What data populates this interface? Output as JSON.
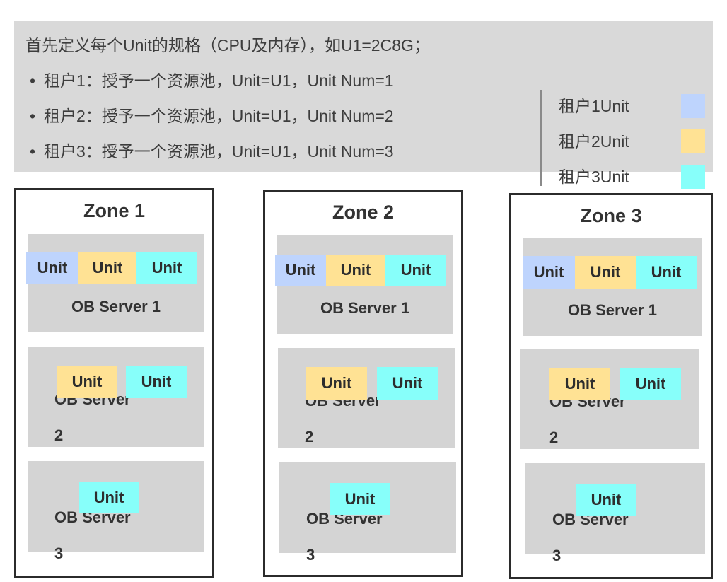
{
  "header": {
    "intro": "首先定义每个Unit的规格（CPU及内存），如U1=2C8G；",
    "bullet_glyph": "•",
    "bullets": [
      "租户1：授予一个资源池，Unit=U1，Unit Num=1",
      "租户2：授予一个资源池，Unit=U1，Unit Num=2",
      "租户3：授予一个资源池，Unit=U1，Unit Num=3"
    ]
  },
  "legend": {
    "items": [
      {
        "label": "租户1Unit",
        "color": "#bed4fd"
      },
      {
        "label": "租户2Unit",
        "color": "#ffe294"
      },
      {
        "label": "租户3Unit",
        "color": "#87fffa"
      }
    ]
  },
  "colors": {
    "tenant1": "#bed4fd",
    "tenant2": "#ffe294",
    "tenant3": "#87fffa",
    "panel_bg": "#d9d9d9",
    "server_bg": "#d4d4d4",
    "zone_border": "#2b2b2b",
    "text": "#3d3d3d"
  },
  "unit_label": "Unit",
  "zones": [
    {
      "title": "Zone 1",
      "servers": [
        {
          "name": "OB Server 1",
          "name_line1": "OB Server 1",
          "name_line2": "",
          "units": [
            {
              "tenant": 1,
              "label": "Unit"
            },
            {
              "tenant": 2,
              "label": "Unit"
            },
            {
              "tenant": 3,
              "label": "Unit"
            }
          ]
        },
        {
          "name": "OB Server 2",
          "name_line1": "OB Server",
          "name_line2": "2",
          "units": [
            {
              "tenant": 2,
              "label": "Unit"
            },
            {
              "tenant": 3,
              "label": "Unit"
            }
          ]
        },
        {
          "name": "OB Server 3",
          "name_line1": "OB Server",
          "name_line2": "3",
          "units": [
            {
              "tenant": 3,
              "label": "Unit"
            }
          ]
        }
      ]
    },
    {
      "title": "Zone 2",
      "servers": [
        {
          "name": "OB Server 1",
          "name_line1": "OB Server 1",
          "name_line2": "",
          "units": [
            {
              "tenant": 1,
              "label": "Unit"
            },
            {
              "tenant": 2,
              "label": "Unit"
            },
            {
              "tenant": 3,
              "label": "Unit"
            }
          ]
        },
        {
          "name": "OB Server 2",
          "name_line1": "OB Server",
          "name_line2": "2",
          "units": [
            {
              "tenant": 2,
              "label": "Unit"
            },
            {
              "tenant": 3,
              "label": "Unit"
            }
          ]
        },
        {
          "name": "OB Server 3",
          "name_line1": "OB Server",
          "name_line2": "3",
          "units": [
            {
              "tenant": 3,
              "label": "Unit"
            }
          ]
        }
      ]
    },
    {
      "title": "Zone 3",
      "servers": [
        {
          "name": "OB Server 1",
          "name_line1": "OB Server 1",
          "name_line2": "",
          "units": [
            {
              "tenant": 1,
              "label": "Unit"
            },
            {
              "tenant": 2,
              "label": "Unit"
            },
            {
              "tenant": 3,
              "label": "Unit"
            }
          ]
        },
        {
          "name": "OB Server 2",
          "name_line1": "OB Server",
          "name_line2": "2",
          "units": [
            {
              "tenant": 2,
              "label": "Unit"
            },
            {
              "tenant": 3,
              "label": "Unit"
            }
          ]
        },
        {
          "name": "OB Server 3",
          "name_line1": "OB Server",
          "name_line2": "3",
          "units": [
            {
              "tenant": 3,
              "label": "Unit"
            }
          ]
        }
      ]
    }
  ]
}
